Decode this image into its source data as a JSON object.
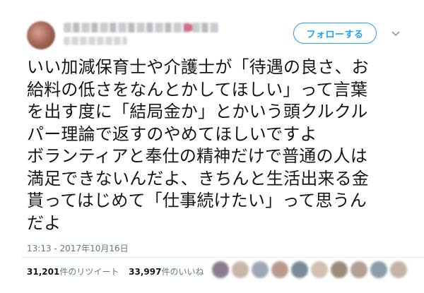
{
  "tweet": {
    "follow_label": "フォローする",
    "text": "いい加減保育士や介護士が「待遇の良さ、お\n給料の低さをなんとかしてほしい」って言葉\nを出す度に「結局金か」とかいう頭クルクル\nパー理論で返すのやめてほしいですよ\nボランティアと奉仕の精神だけで普通の人は\n満足できないんだよ、きちんと生活出来る金\n貰ってはじめて「仕事続けたい」って思うん\nだよ",
    "timestamp": "13:13 - 2017年10月16日"
  },
  "stats": {
    "retweet_count": "31,201",
    "retweet_label": "件のリツイート",
    "like_count": "33,997",
    "like_label": "件のいいね"
  },
  "colors": {
    "accent": "#1da1f2",
    "muted": "#657786",
    "text": "#14171a"
  },
  "liker_colors": [
    "#8a7c8f",
    "#c8b8a8",
    "#a0a8b4",
    "#b89a8c",
    "#7a8a98",
    "#d0c0b0",
    "#9c8c7c",
    "#b0a098",
    "#8c9ca8",
    "#c4b4a4"
  ]
}
